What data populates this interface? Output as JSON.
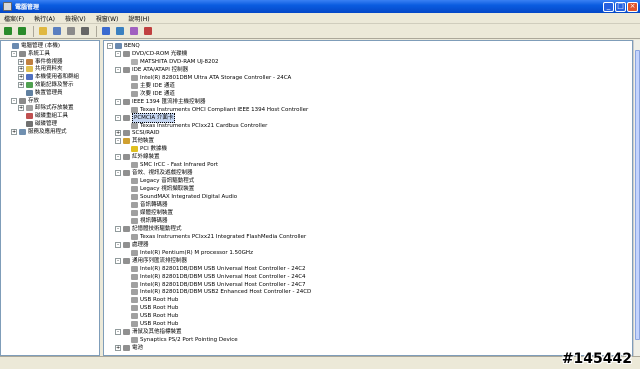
{
  "window": {
    "title": "電腦管理",
    "controls": [
      "_",
      "□",
      "×"
    ]
  },
  "menu": [
    "檔案(F)",
    "執行(A)",
    "檢視(V)",
    "視窗(W)",
    "說明(H)"
  ],
  "toolbar": [
    {
      "icon": "back-icon",
      "color": "#2a8b2a"
    },
    {
      "icon": "forward-icon",
      "color": "#2a8b2a"
    },
    {
      "icon": "up-folder-icon",
      "color": "#e0b840"
    },
    {
      "icon": "console-icon",
      "color": "#5a7fc0"
    },
    {
      "icon": "properties-icon",
      "color": "#8a8a8a"
    },
    {
      "icon": "print-icon",
      "color": "#666666"
    },
    {
      "icon": "help-icon",
      "color": "#3a6ad0"
    },
    {
      "icon": "scan-icon",
      "color": "#3a80c0"
    },
    {
      "icon": "update-driver-icon",
      "color": "#a060c0"
    },
    {
      "icon": "uninstall-icon",
      "color": "#c04040"
    }
  ],
  "left_tree": [
    {
      "label": "電腦管理 (本機)",
      "exp": "",
      "icon": "#6a8ab0",
      "lvl": 0
    },
    {
      "label": "系統工具",
      "exp": "-",
      "icon": "#8a8a8a",
      "lvl": 1
    },
    {
      "label": "事件檢視器",
      "exp": "+",
      "icon": "#c08040",
      "lvl": 2
    },
    {
      "label": "共用資料夾",
      "exp": "+",
      "icon": "#e0c050",
      "lvl": 2
    },
    {
      "label": "本機使用者和群組",
      "exp": "+",
      "icon": "#5070c0",
      "lvl": 2
    },
    {
      "label": "效能記錄及警示",
      "exp": "+",
      "icon": "#50a050",
      "lvl": 2
    },
    {
      "label": "裝置管理員",
      "exp": "",
      "icon": "#6080a0",
      "lvl": 2
    },
    {
      "label": "存放",
      "exp": "-",
      "icon": "#8a8a8a",
      "lvl": 1
    },
    {
      "label": "卸除式存放裝置",
      "exp": "+",
      "icon": "#a0a0a0",
      "lvl": 2
    },
    {
      "label": "磁碟重組工具",
      "exp": "",
      "icon": "#c05050",
      "lvl": 2
    },
    {
      "label": "磁碟管理",
      "exp": "",
      "icon": "#707070",
      "lvl": 2
    },
    {
      "label": "服務及應用程式",
      "exp": "+",
      "icon": "#7090b0",
      "lvl": 1
    }
  ],
  "device_tree": [
    {
      "label": "BENQ",
      "exp": "-",
      "icon": "#6a8ab0",
      "lvl": 0
    },
    {
      "label": "DVD/CD-ROM 光碟機",
      "exp": "-",
      "icon": "#909090",
      "lvl": 1
    },
    {
      "label": "MATSHITA DVD-RAM UJ-8202",
      "exp": "",
      "icon": "#b0b0b0",
      "lvl": 2
    },
    {
      "label": "IDE ATA/ATAPI 控制器",
      "exp": "-",
      "icon": "#909090",
      "lvl": 1
    },
    {
      "label": "Intel(R) 82801DBM Ultra ATA Storage Controller - 24CA",
      "exp": "",
      "icon": "#a0a0a0",
      "lvl": 2
    },
    {
      "label": "主要 IDE 通道",
      "exp": "",
      "icon": "#a0a0a0",
      "lvl": 2
    },
    {
      "label": "次要 IDE 通道",
      "exp": "",
      "icon": "#a0a0a0",
      "lvl": 2
    },
    {
      "label": "IEEE 1394 匯流排主機控制器",
      "exp": "-",
      "icon": "#909090",
      "lvl": 1
    },
    {
      "label": "Texas Instruments OHCI Compliant IEEE 1394 Host Controller",
      "exp": "",
      "icon": "#a0a0a0",
      "lvl": 2
    },
    {
      "label": "PCMCIA 介面卡",
      "exp": "-",
      "icon": "#909090",
      "lvl": 1,
      "state": "selected"
    },
    {
      "label": "Texas Instruments PCIxx21 Cardbus Controller",
      "exp": "",
      "icon": "#a0a0a0",
      "lvl": 2
    },
    {
      "label": "SCSI/RAID",
      "exp": "+",
      "icon": "#909090",
      "lvl": 1
    },
    {
      "label": "其他裝置",
      "exp": "-",
      "icon": "#d0a030",
      "lvl": 1
    },
    {
      "label": "PCI 數據機",
      "exp": "",
      "icon": "#e0c020",
      "lvl": 2
    },
    {
      "label": "紅外線裝置",
      "exp": "-",
      "icon": "#909090",
      "lvl": 1
    },
    {
      "label": "SMC IrCC - Fast Infrared Port",
      "exp": "",
      "icon": "#a0a0a0",
      "lvl": 2
    },
    {
      "label": "音效、視訊及遊戲控制器",
      "exp": "-",
      "icon": "#909090",
      "lvl": 1
    },
    {
      "label": "Legacy 音訊驅動程式",
      "exp": "",
      "icon": "#a0a0a0",
      "lvl": 2
    },
    {
      "label": "Legacy 視訊擷取裝置",
      "exp": "",
      "icon": "#a0a0a0",
      "lvl": 2
    },
    {
      "label": "SoundMAX Integrated Digital Audio",
      "exp": "",
      "icon": "#a0a0a0",
      "lvl": 2
    },
    {
      "label": "音訊轉碼器",
      "exp": "",
      "icon": "#a0a0a0",
      "lvl": 2
    },
    {
      "label": "媒體控制裝置",
      "exp": "",
      "icon": "#a0a0a0",
      "lvl": 2
    },
    {
      "label": "視訊轉碼器",
      "exp": "",
      "icon": "#a0a0a0",
      "lvl": 2
    },
    {
      "label": "記憶體技術驅動程式",
      "exp": "-",
      "icon": "#909090",
      "lvl": 1
    },
    {
      "label": "Texas Instruments PCIxx21 Integrated FlashMedia Controller",
      "exp": "",
      "icon": "#a0a0a0",
      "lvl": 2
    },
    {
      "label": "處理器",
      "exp": "-",
      "icon": "#909090",
      "lvl": 1
    },
    {
      "label": "Intel(R) Pentium(R) M processor 1.50GHz",
      "exp": "",
      "icon": "#a0a0a0",
      "lvl": 2
    },
    {
      "label": "通用序列匯流排控制器",
      "exp": "-",
      "icon": "#909090",
      "lvl": 1
    },
    {
      "label": "Intel(R) 82801DB/DBM USB Universal Host Controller - 24C2",
      "exp": "",
      "icon": "#a0a0a0",
      "lvl": 2
    },
    {
      "label": "Intel(R) 82801DB/DBM USB Universal Host Controller - 24C4",
      "exp": "",
      "icon": "#a0a0a0",
      "lvl": 2
    },
    {
      "label": "Intel(R) 82801DB/DBM USB Universal Host Controller - 24C7",
      "exp": "",
      "icon": "#a0a0a0",
      "lvl": 2
    },
    {
      "label": "Intel(R) 82801DB/DBM USB2 Enhanced Host Controller - 24CD",
      "exp": "",
      "icon": "#a0a0a0",
      "lvl": 2
    },
    {
      "label": "USB Root Hub",
      "exp": "",
      "icon": "#a0a0a0",
      "lvl": 2
    },
    {
      "label": "USB Root Hub",
      "exp": "",
      "icon": "#a0a0a0",
      "lvl": 2
    },
    {
      "label": "USB Root Hub",
      "exp": "",
      "icon": "#a0a0a0",
      "lvl": 2
    },
    {
      "label": "USB Root Hub",
      "exp": "",
      "icon": "#a0a0a0",
      "lvl": 2
    },
    {
      "label": "滑鼠及其他指標裝置",
      "exp": "-",
      "icon": "#909090",
      "lvl": 1
    },
    {
      "label": "Synaptics PS/2 Port Pointing Device",
      "exp": "",
      "icon": "#a0a0a0",
      "lvl": 2
    },
    {
      "label": "電池",
      "exp": "+",
      "icon": "#909090",
      "lvl": 1
    }
  ],
  "watermark": "#145442"
}
